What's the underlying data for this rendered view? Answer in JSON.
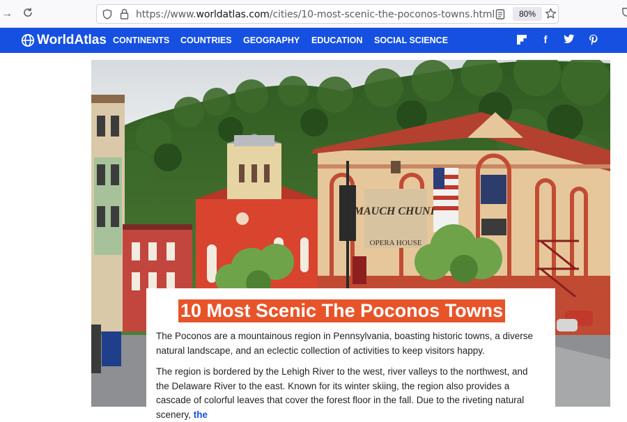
{
  "browser": {
    "url_prefix": "https://www.",
    "url_domain": "worldatlas.com",
    "url_path": "/cities/10-most-scenic-the-poconos-towns.html",
    "zoom": "80%"
  },
  "site": {
    "logo": "WorldAtlas",
    "nav": [
      "CONTINENTS",
      "COUNTRIES",
      "GEOGRAPHY",
      "EDUCATION",
      "SOCIAL SCIENCE"
    ],
    "social_icons": [
      "flipboard-icon",
      "facebook-icon",
      "twitter-icon",
      "pinterest-icon"
    ]
  },
  "hero": {
    "sign_text": "MAUCH CHUNK",
    "sign_sub": "OPERA HOUSE"
  },
  "article": {
    "title": "10 Most Scenic The Poconos Towns",
    "p1": "The Poconos are a mountainous region in Pennsylvania, boasting historic towns, a diverse natural landscape, and an eclectic collection of activities to keep visitors happy.",
    "p2_text": "The region is bordered by the Lehigh River to the west, river valleys to the northwest, and the Delaware River to the east. Known for its winter skiing, the region also provides a cascade of colorful leaves that cover the forest floor in the fall. Due to the riveting natural scenery, ",
    "p2_link": "the"
  },
  "colors": {
    "nav_bg": "#1650e0",
    "title_bg": "#e8542a"
  }
}
